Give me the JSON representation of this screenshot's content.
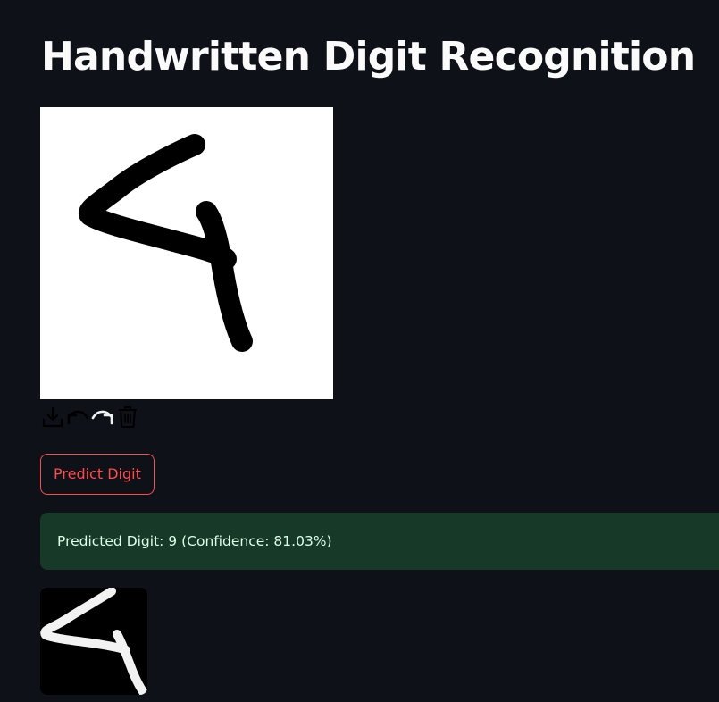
{
  "page": {
    "title": "Handwritten Digit Recognition"
  },
  "toolbar": {
    "icons": [
      "download-icon",
      "undo-icon",
      "redo-icon",
      "trash-icon"
    ]
  },
  "predict_button": {
    "label": "Predict Digit"
  },
  "result": {
    "message": "Predicted Digit: 9 (Confidence: 81.03%)"
  },
  "colors": {
    "background": "#0e1117",
    "accent": "#ff4b4b",
    "success_bg": "#173928",
    "success_text": "#dffde9"
  }
}
